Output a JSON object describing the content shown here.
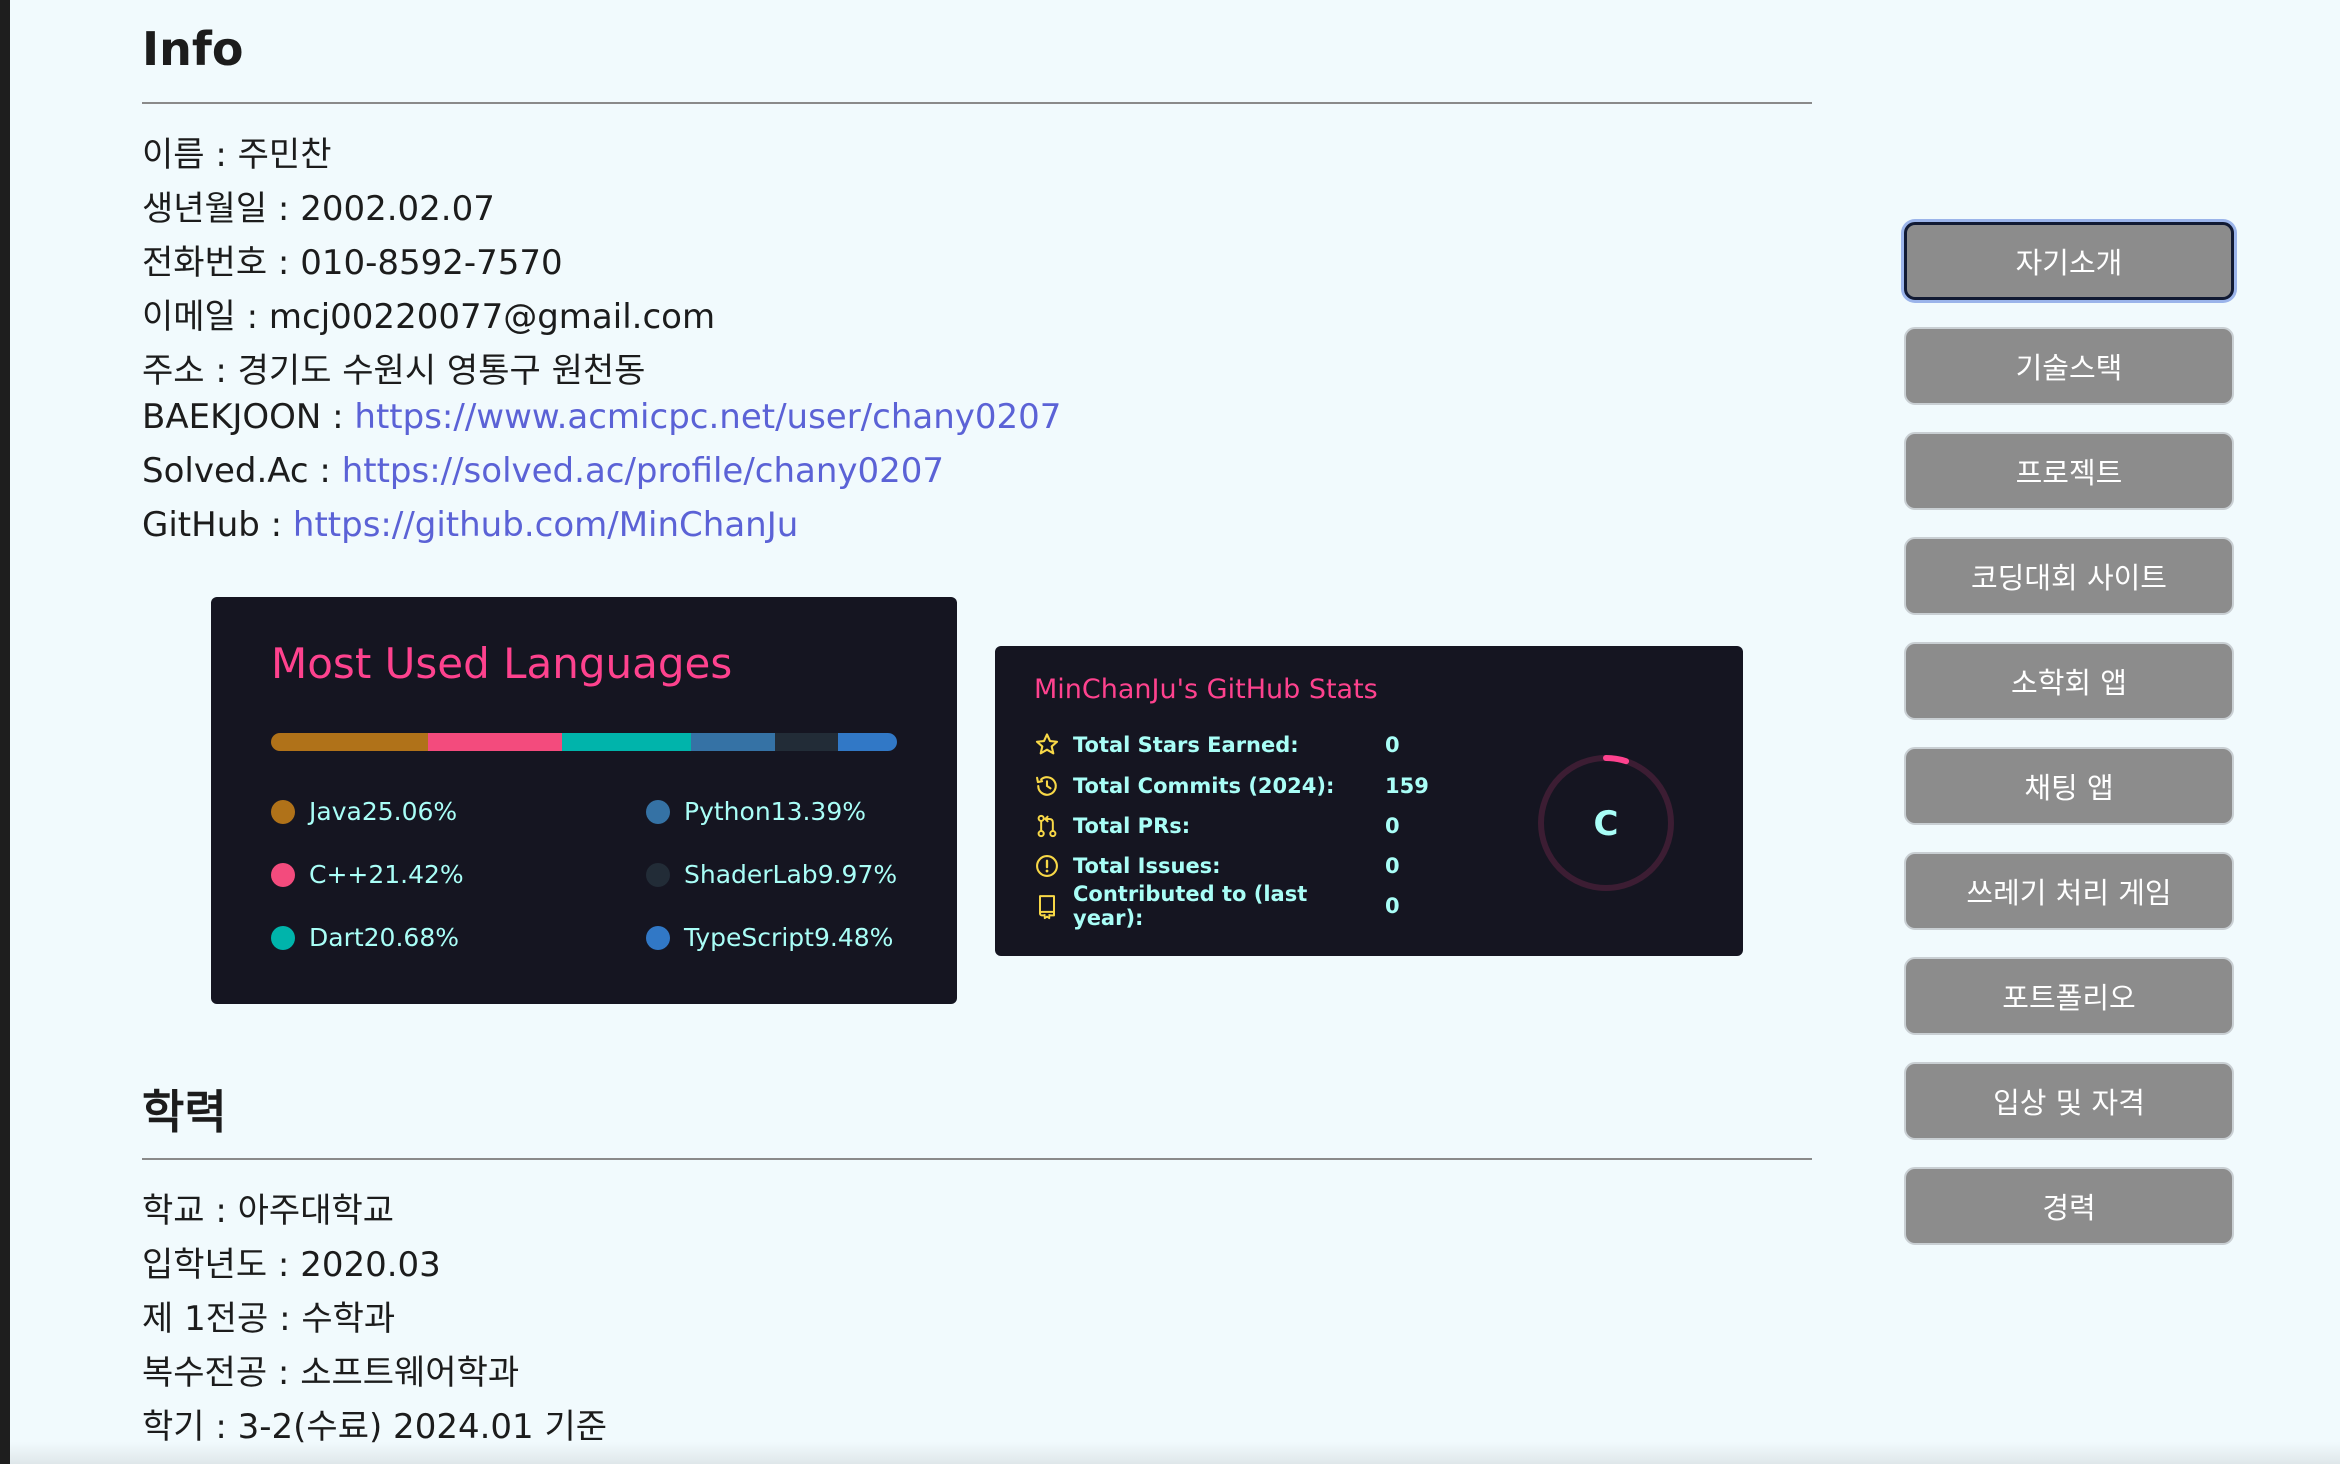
{
  "info": {
    "title": "Info",
    "name": "이름 : 주민찬",
    "birth": "생년월일 : 2002.02.07",
    "phone": "전화번호 : 010-8592-7570",
    "email": "이메일 : mcj00220077@gmail.com",
    "address": "주소 : 경기도 수원시 영통구 원천동",
    "baekjoon_label": "BAEKJOON : ",
    "baekjoon_url": "https://www.acmicpc.net/user/chany0207",
    "solved_label": "Solved.Ac : ",
    "solved_url": "https://solved.ac/profile/chany0207",
    "github_label": "GitHub : ",
    "github_url": "https://github.com/MinChanJu"
  },
  "languages": {
    "title": "Most Used Languages",
    "items": [
      {
        "name": "Java",
        "percent": "25.06%",
        "value": 25.06,
        "color": "#b07219"
      },
      {
        "name": "C++",
        "percent": "21.42%",
        "value": 21.42,
        "color": "#f34b7d"
      },
      {
        "name": "Dart",
        "percent": "20.68%",
        "value": 20.68,
        "color": "#00b4ab"
      },
      {
        "name": "Python",
        "percent": "13.39%",
        "value": 13.39,
        "color": "#3572a5"
      },
      {
        "name": "ShaderLab",
        "percent": "9.97%",
        "value": 9.97,
        "color": "#222c37"
      },
      {
        "name": "TypeScript",
        "percent": "9.48%",
        "value": 9.48,
        "color": "#3178c6"
      }
    ]
  },
  "stats": {
    "title": "MinChanJu's GitHub Stats",
    "rows": [
      {
        "label": "Total Stars Earned:",
        "value": "0",
        "icon": "star-icon"
      },
      {
        "label": "Total Commits (2024):",
        "value": "159",
        "icon": "history-icon"
      },
      {
        "label": "Total PRs:",
        "value": "0",
        "icon": "pull-request-icon"
      },
      {
        "label": "Total Issues:",
        "value": "0",
        "icon": "issue-icon"
      },
      {
        "label": "Contributed to (last year):",
        "value": "0",
        "icon": "repo-icon"
      }
    ],
    "rank": "C",
    "rank_progress": 0.05,
    "colors": {
      "accent": "#fe428e",
      "text": "#a9fef7",
      "icon": "#f8d847",
      "background": "#151521"
    }
  },
  "education": {
    "title": "학력",
    "school": "학교 : 아주대학교",
    "admission": "입학년도 : 2020.03",
    "major": "제 1전공 : 수학과",
    "double_major": "복수전공 : 소프트웨어학과",
    "semester": "학기 : 3-2(수료) 2024.01 기준"
  },
  "nav": {
    "items": [
      "자기소개",
      "기술스택",
      "프로젝트",
      "코딩대회 사이트",
      "소학회 앱",
      "채팅 앱",
      "쓰레기 처리 게임",
      "포트폴리오",
      "입상 및 자격",
      "경력"
    ],
    "active_index": 0
  }
}
